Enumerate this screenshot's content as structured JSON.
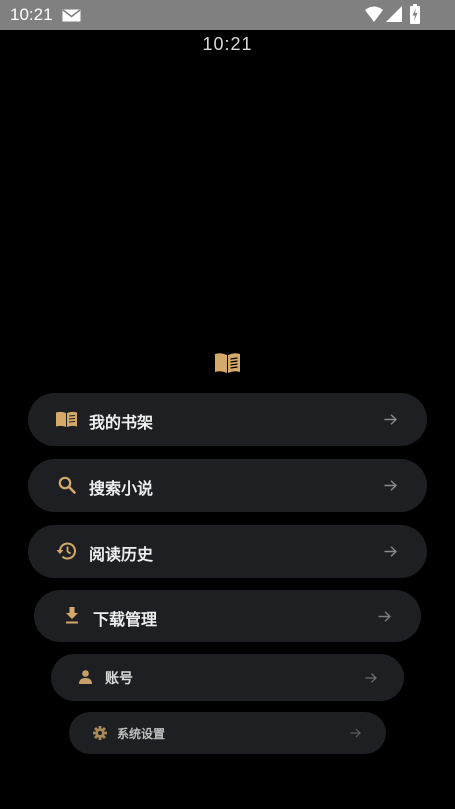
{
  "status_bar": {
    "time": "10:21"
  },
  "clock": "10:21",
  "colors": {
    "accent": "#d4a96a",
    "card": "#1d1f22",
    "status_bar": "#808080",
    "background": "#000000"
  },
  "menu": {
    "items": [
      {
        "label": "我的书架",
        "icon": "book-open-icon"
      },
      {
        "label": "搜索小说",
        "icon": "search-icon"
      },
      {
        "label": "阅读历史",
        "icon": "history-icon"
      },
      {
        "label": "下载管理",
        "icon": "download-icon"
      },
      {
        "label": "账号",
        "icon": "person-icon"
      },
      {
        "label": "系统设置",
        "icon": "gear-icon"
      }
    ]
  }
}
